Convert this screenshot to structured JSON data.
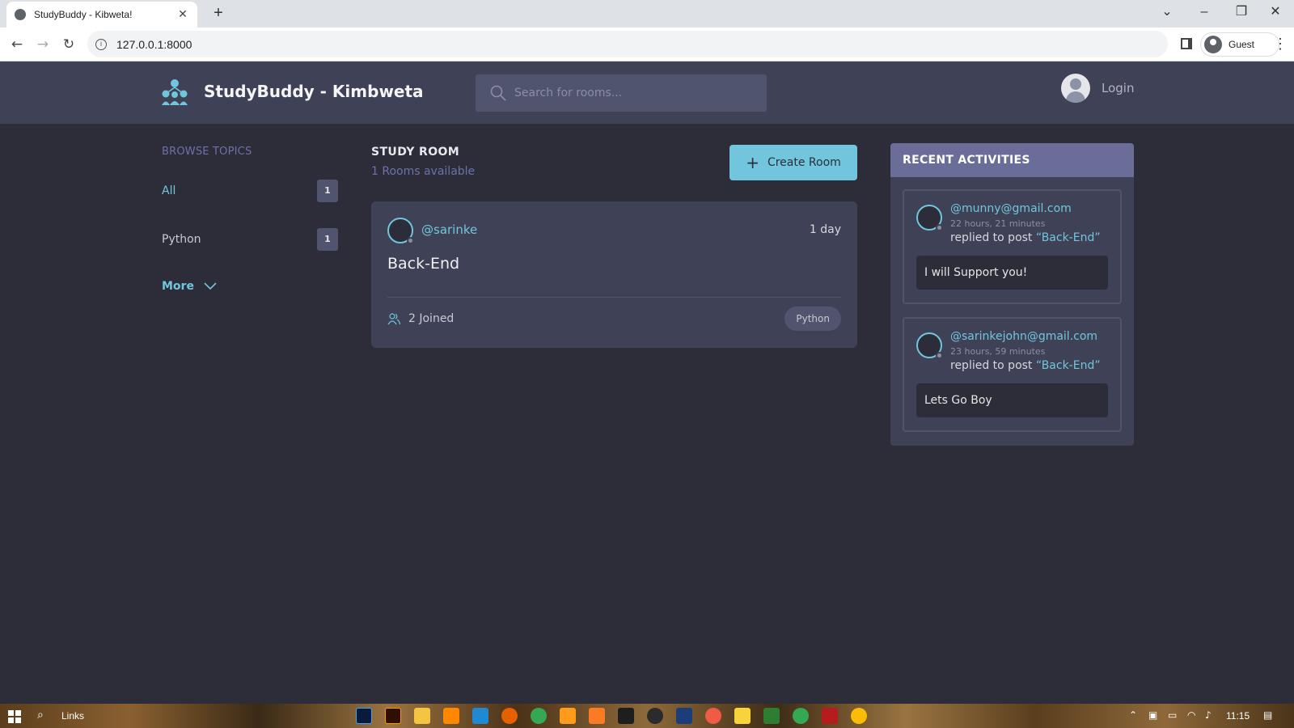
{
  "browser": {
    "tab_title": "StudyBuddy - Kibweta!",
    "new_tab": "+",
    "url": "127.0.0.1:8000",
    "profile_name": "Guest"
  },
  "header": {
    "brand": "StudyBuddy - Kimbweta",
    "search_placeholder": "Search for rooms...",
    "login_label": "Login"
  },
  "topics": {
    "title": "BROWSE TOPICS",
    "items": [
      {
        "label": "All",
        "count": "1"
      },
      {
        "label": "Python",
        "count": "1"
      }
    ],
    "more_label": "More"
  },
  "feed": {
    "title": "STUDY ROOM",
    "subtitle": "1 Rooms available",
    "create_label": "Create Room",
    "rooms": [
      {
        "host": "@sarinke",
        "time": "1 day",
        "name": "Back-End",
        "joined": "2 Joined",
        "topic": "Python"
      }
    ]
  },
  "activities": {
    "title": "RECENT ACTIVITIES",
    "items": [
      {
        "user": "@munny@gmail.com",
        "time": "22 hours, 21 minutes",
        "action": "replied to post",
        "post": "“Back-End”",
        "body": "I will Support you!"
      },
      {
        "user": "@sarinkejohn@gmail.com",
        "time": "23 hours, 59 minutes",
        "action": "replied to post",
        "post": "“Back-End”",
        "body": "Lets Go Boy"
      }
    ]
  },
  "taskbar": {
    "search_label": "Links",
    "clock": "11:15"
  },
  "colors": {
    "background": "#2d2d39",
    "panel": "#3f4156",
    "accent": "#71c6dd",
    "muted_purple": "#6e71a8",
    "activity_header": "#696d97"
  }
}
